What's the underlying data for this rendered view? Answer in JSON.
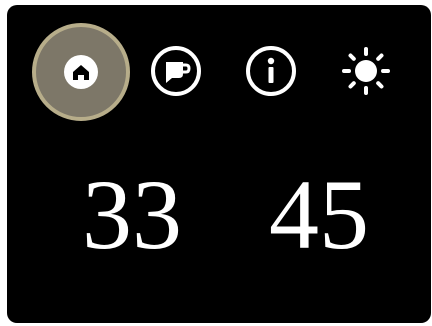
{
  "toolbar": {
    "items": [
      {
        "icon": "home-icon",
        "selected": true
      },
      {
        "icon": "mug-icon",
        "selected": false
      },
      {
        "icon": "info-icon",
        "selected": false
      },
      {
        "icon": "sun-icon",
        "selected": false
      }
    ]
  },
  "readouts": {
    "left_value": "33",
    "right_value": "45"
  },
  "colors": {
    "background": "#000000",
    "selected_fill": "#7d7768",
    "selected_ring": "#b7ad8a",
    "foreground": "#ffffff"
  }
}
